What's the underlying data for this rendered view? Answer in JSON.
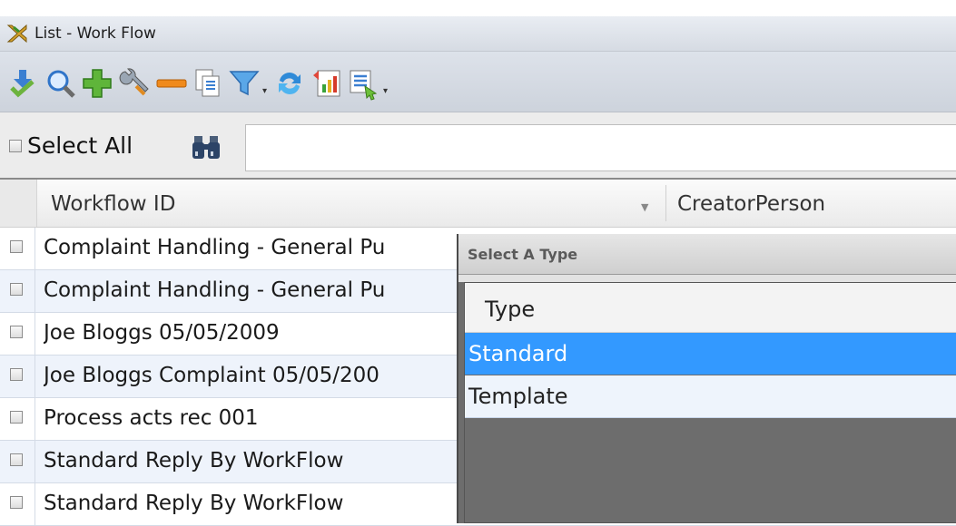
{
  "window": {
    "title": "List - Work Flow"
  },
  "toolbar": {
    "icons": [
      "download-check-icon",
      "search-icon",
      "add-icon",
      "wrench-icon",
      "remove-icon",
      "copy-icon",
      "filter-icon",
      "refresh-icon",
      "report-icon",
      "export-icon"
    ]
  },
  "selectbar": {
    "select_all_label": "Select All",
    "search_value": ""
  },
  "grid": {
    "columns": [
      "Workflow ID",
      "CreatorPerson"
    ],
    "rows": [
      "Complaint Handling - General Pu",
      "Complaint Handling - General Pu",
      "Joe Bloggs 05/05/2009",
      "Joe Bloggs Complaint 05/05/200",
      "Process acts rec 001",
      "Standard Reply By WorkFlow",
      "Standard Reply By WorkFlow"
    ]
  },
  "popup": {
    "title": "Select A Type",
    "column": "Type",
    "options": [
      "Standard",
      "Template"
    ],
    "selected": "Standard"
  },
  "colors": {
    "selection": "#3399ff",
    "row_alt": "#eef3fb",
    "popup_backdrop": "#6d6d6d"
  }
}
